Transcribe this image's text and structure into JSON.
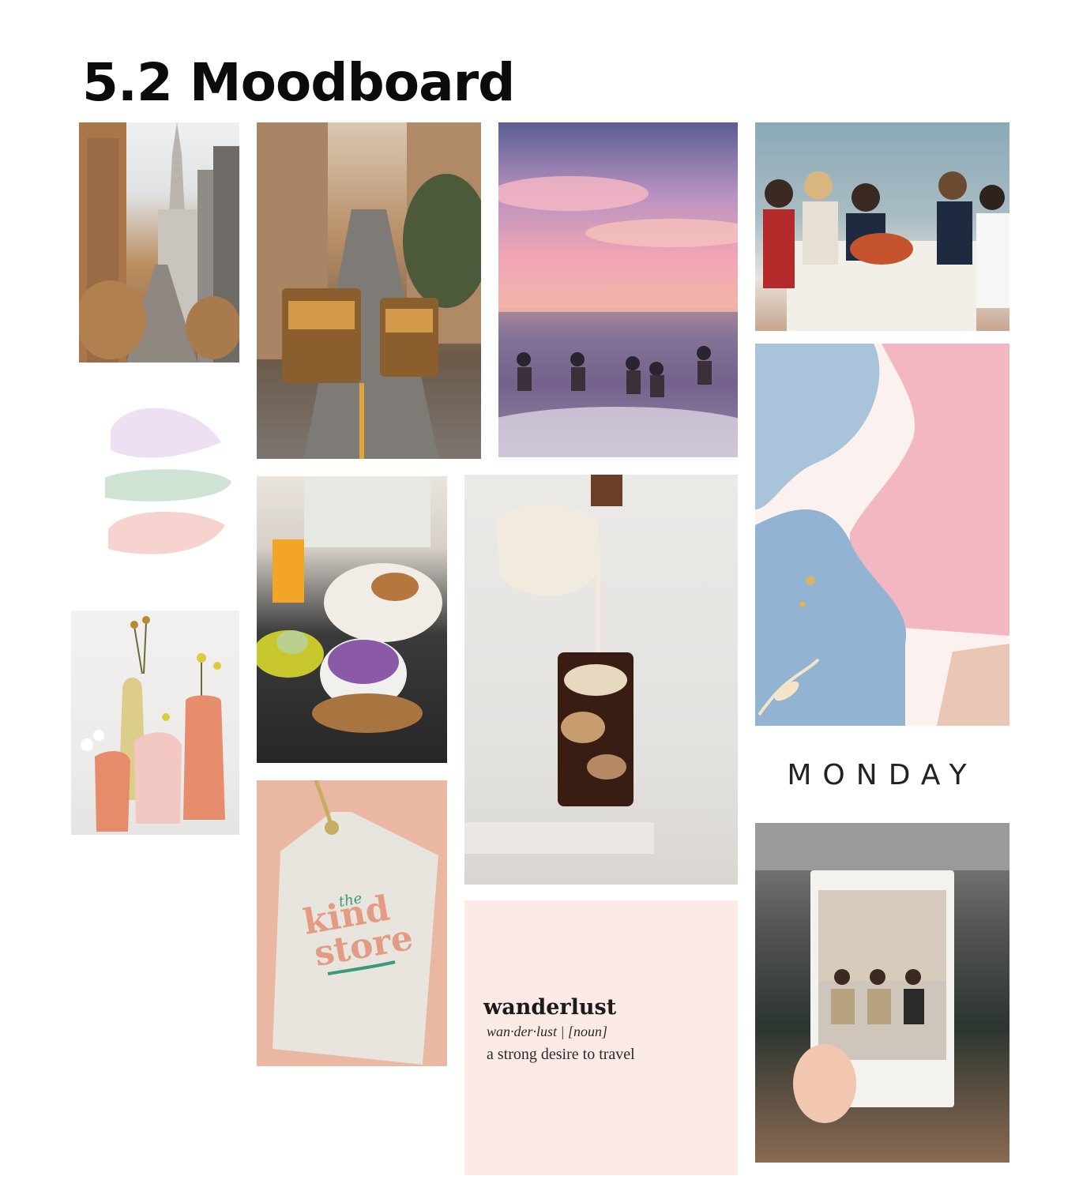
{
  "page": {
    "title": "5.2 Moodboard"
  },
  "tiles": {
    "monday_logo": "MONDAY",
    "kind_store": {
      "small": "the",
      "line1": "kind",
      "line2": "store"
    },
    "wanderlust": {
      "word": "wanderlust",
      "pronunciation": "wan·der·lust | [noun]",
      "definition": "a strong desire to travel"
    }
  },
  "colors": {
    "pink": "#f2b7c1",
    "peach": "#eab8a2",
    "blue": "#93b3d3",
    "mint": "#cfe3d4",
    "lavender": "#ece0f2"
  }
}
